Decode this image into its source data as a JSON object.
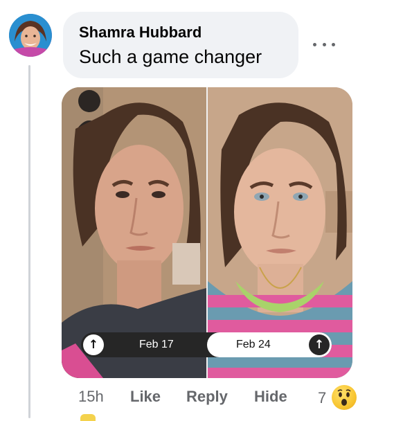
{
  "comment": {
    "author": "Shamra Hubbard",
    "text": "Such a game changer",
    "attachment": {
      "left_date": "Feb 17",
      "right_date": "Feb 24",
      "arrow_icon": "↑"
    },
    "actions": {
      "time": "15h",
      "like": "Like",
      "reply": "Reply",
      "hide": "Hide"
    },
    "reactions": {
      "count": "7",
      "emoji": "wow-emoji"
    }
  },
  "colors": {
    "bubble": "#f0f2f5",
    "meta_text": "#65676b",
    "primary_text": "#050505"
  }
}
